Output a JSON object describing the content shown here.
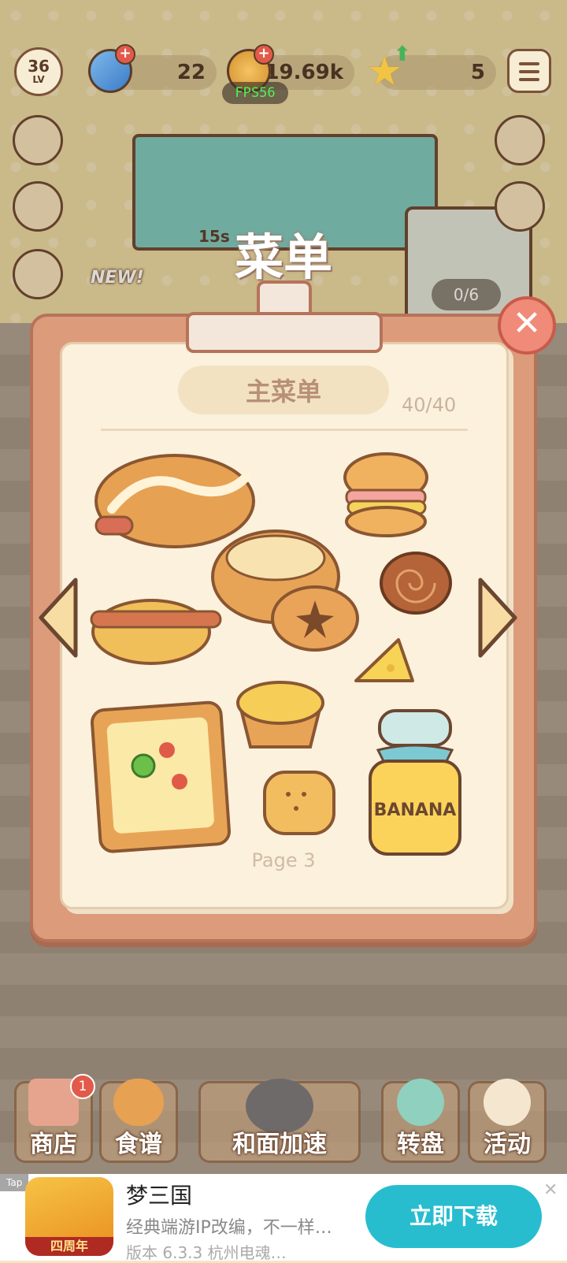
{
  "hud": {
    "level": "36",
    "level_unit": "LV",
    "gems": "22",
    "coins": "19.69k",
    "stars": "5",
    "fps": "FPS56"
  },
  "scene": {
    "new_badge": "NEW!",
    "timer": "15s",
    "customer_counter": "0/6"
  },
  "menu": {
    "title": "菜单",
    "subtitle": "主菜单",
    "count": "40/40",
    "page": "Page 3",
    "jar_label": "BANANA"
  },
  "nav": [
    {
      "label": "商店",
      "badge": "1"
    },
    {
      "label": "食谱"
    },
    {
      "label": "和面加速"
    },
    {
      "label": "转盘"
    },
    {
      "label": "活动"
    }
  ],
  "ad": {
    "tag": "Tap",
    "app_name": "梦三国",
    "year_badge": "四周年",
    "description": "经典端游IP改编，不一样…",
    "version": "版本 6.3.3  杭州电魂…",
    "cta": "立即下载"
  },
  "colors": {
    "board": "#dc9b7b",
    "paper": "#fbf1dc",
    "close": "#ef8b78",
    "cta": "#27bdcf",
    "fps": "#53f05a"
  }
}
